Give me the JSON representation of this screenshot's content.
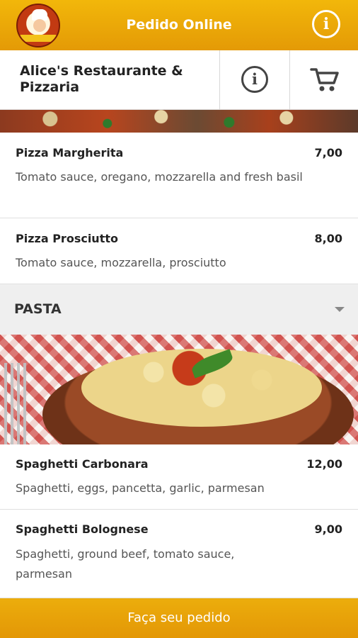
{
  "header": {
    "title": "Pedido Online",
    "logo_icon": "chef-logo-icon",
    "info_icon": "info-icon",
    "info_glyph": "i",
    "color": "#f0b00a"
  },
  "restaurant": {
    "name": "Alice's Restaurante & Pizzaria",
    "info_icon": "info-icon",
    "info_glyph": "i",
    "cart_icon": "cart-icon"
  },
  "pizza_items": [
    {
      "name": "Pizza Margherita",
      "price": "7,00",
      "description": "Tomato sauce, oregano, mozzarella and fresh basil"
    },
    {
      "name": "Pizza Prosciutto",
      "price": "8,00",
      "description": "Tomato sauce, mozzarella, prosciutto"
    }
  ],
  "pasta_section": {
    "title": "PASTA",
    "chevron_icon": "chevron-down-icon",
    "items": [
      {
        "name": "Spaghetti Carbonara",
        "price": "12,00",
        "description": "Spaghetti, eggs, pancetta, garlic, parmesan"
      },
      {
        "name": "Spaghetti Bolognese",
        "price": "9,00",
        "description": "Spaghetti, ground beef, tomato sauce, parmesan"
      }
    ]
  },
  "footer": {
    "order_label": "Faça seu pedido"
  }
}
